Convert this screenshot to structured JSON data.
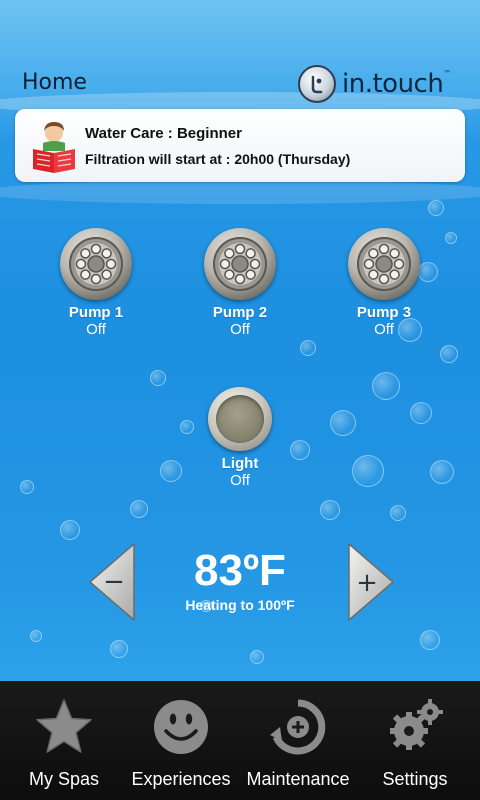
{
  "header": {
    "title": "Home",
    "brand_name": "in.touch",
    "brand_tm": "™",
    "brand_icon": "intouch-logo-icon"
  },
  "status_card": {
    "title": "Water Care : Beginner",
    "subtitle": "Filtration will start at : 20h00 (Thursday)",
    "icon": "reading-person-icon"
  },
  "controls": {
    "pumps": [
      {
        "name": "Pump 1",
        "state": "Off"
      },
      {
        "name": "Pump 2",
        "state": "Off"
      },
      {
        "name": "Pump 3",
        "state": "Off"
      }
    ],
    "light": {
      "name": "Light",
      "state": "Off"
    }
  },
  "temperature": {
    "value": "83ºF",
    "status": "Heating to 100ºF",
    "decrease_label": "−",
    "increase_label": "+"
  },
  "nav": {
    "items": [
      {
        "label": "My Spas",
        "icon": "star-icon"
      },
      {
        "label": "Experiences",
        "icon": "smiley-icon"
      },
      {
        "label": "Maintenance",
        "icon": "maintenance-icon"
      },
      {
        "label": "Settings",
        "icon": "gears-icon"
      }
    ]
  },
  "colors": {
    "water_blue": "#1d8fe0",
    "nav_background": "#111111",
    "text_white": "#ffffff"
  }
}
